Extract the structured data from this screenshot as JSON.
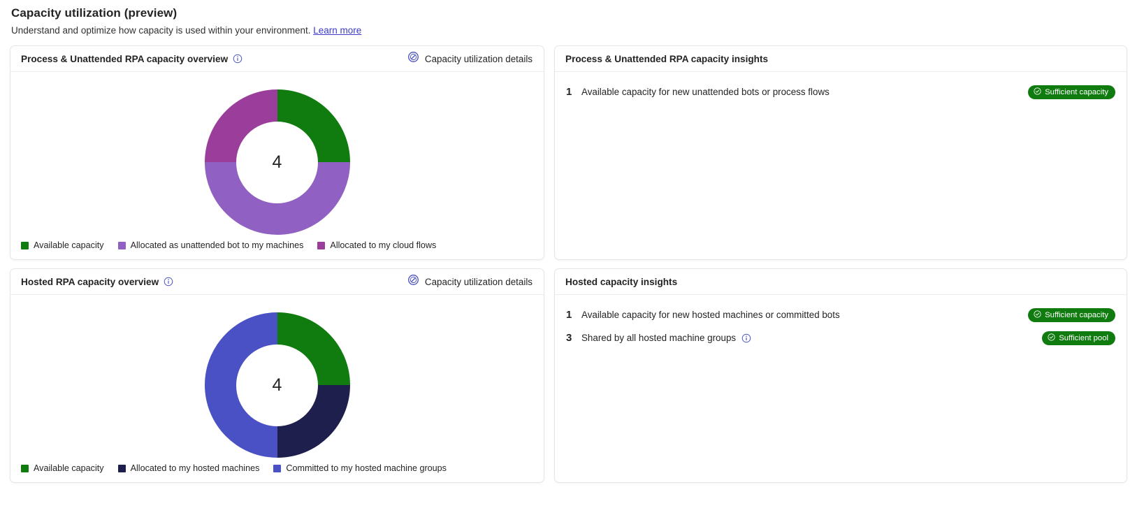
{
  "header": {
    "title": "Capacity utilization (preview)",
    "subtitle": "Understand and optimize how capacity is used within your environment.",
    "learn_more": "Learn more"
  },
  "colors": {
    "green": "#107c10",
    "light_purple": "#9061c2",
    "magenta_purple": "#9b3d9b",
    "navy": "#1f1f4d",
    "indigo": "#4a51c4",
    "link_blue": "#3b3bc4",
    "badge_green": "#107c10"
  },
  "cards": {
    "process_overview": {
      "title": "Process & Unattended RPA capacity overview",
      "info_icon": "info-icon",
      "details_link": "Capacity utilization details",
      "details_icon": "gauge-icon",
      "center_value": "4",
      "legend": [
        {
          "label": "Available capacity",
          "color": "#107c10"
        },
        {
          "label": "Allocated as unattended bot to my machines",
          "color": "#9061c2"
        },
        {
          "label": "Allocated to my cloud flows",
          "color": "#9b3d9b"
        }
      ]
    },
    "process_insights": {
      "title": "Process & Unattended RPA capacity insights",
      "rows": [
        {
          "number": "1",
          "text": "Available capacity for new unattended bots or process flows",
          "badge": "Sufficient capacity",
          "badge_icon": "check-circle-icon",
          "has_info": false
        }
      ]
    },
    "hosted_overview": {
      "title": "Hosted RPA capacity overview",
      "info_icon": "info-icon",
      "details_link": "Capacity utilization details",
      "details_icon": "gauge-icon",
      "center_value": "4",
      "legend": [
        {
          "label": "Available capacity",
          "color": "#107c10"
        },
        {
          "label": "Allocated to my hosted machines",
          "color": "#1f1f4d"
        },
        {
          "label": "Committed to my hosted machine groups",
          "color": "#4a51c4"
        }
      ]
    },
    "hosted_insights": {
      "title": "Hosted capacity insights",
      "rows": [
        {
          "number": "1",
          "text": "Available capacity for new hosted machines or committed bots",
          "badge": "Sufficient capacity",
          "badge_icon": "check-circle-icon",
          "has_info": false
        },
        {
          "number": "3",
          "text": "Shared by all hosted machine groups",
          "badge": "Sufficient pool",
          "badge_icon": "check-circle-icon",
          "has_info": true
        }
      ]
    }
  },
  "chart_data": [
    {
      "type": "pie",
      "title": "Process & Unattended RPA capacity overview",
      "center_label": "4",
      "total": 4,
      "categories": [
        "Available capacity",
        "Allocated as unattended bot to my machines",
        "Allocated to my cloud flows"
      ],
      "values": [
        1,
        2,
        1
      ],
      "percentages": [
        25,
        50,
        25
      ],
      "colors": [
        "#107c10",
        "#9061c2",
        "#9b3d9b"
      ],
      "legend_position": "bottom-left",
      "grid": false
    },
    {
      "type": "pie",
      "title": "Hosted RPA capacity overview",
      "center_label": "4",
      "total": 4,
      "categories": [
        "Available capacity",
        "Allocated to my hosted machines",
        "Committed to my hosted machine groups"
      ],
      "values": [
        1,
        1,
        2
      ],
      "percentages": [
        25,
        25,
        50
      ],
      "colors": [
        "#107c10",
        "#1f1f4d",
        "#4a51c4"
      ],
      "legend_position": "bottom-left",
      "grid": false
    }
  ]
}
